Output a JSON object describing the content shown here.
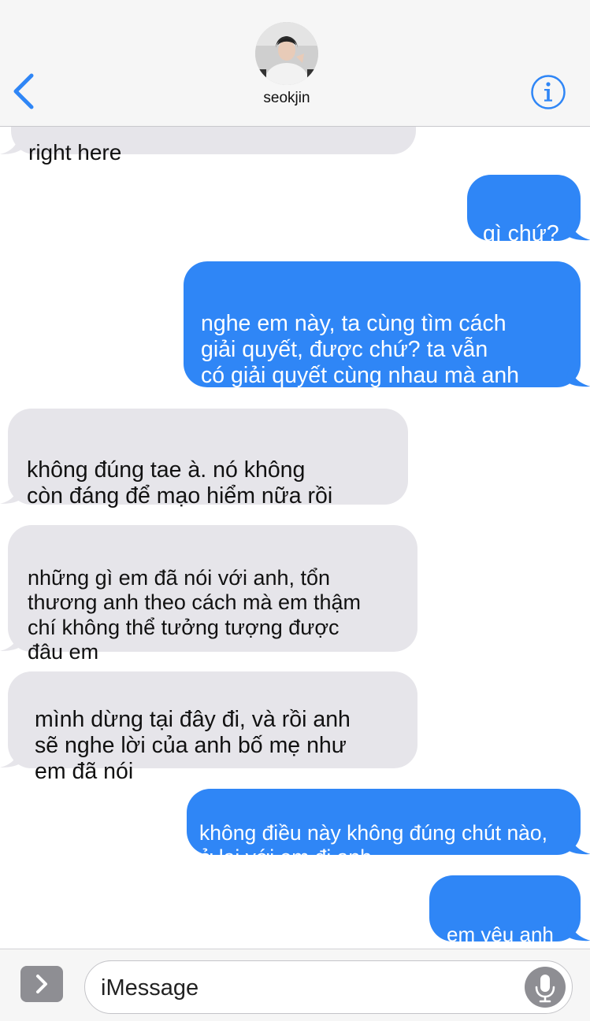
{
  "header": {
    "contact_name": "seokjin"
  },
  "messages": {
    "clipped_top": "right here",
    "m1": "gì chứ?",
    "m2": "nghe em này, ta cùng tìm cách\ngiải quyết, được chứ? ta vẫn\ncó giải quyết cùng nhau mà anh",
    "m3": "không đúng tae à. nó không\ncòn đáng để mạo hiểm nữa rồi",
    "m4": "những gì em đã nói với anh, tổn\nthương anh theo cách mà em thậm\nchí không thể tưởng tượng được\nđâu em",
    "m5": "mình dừng tại đây đi, và rồi anh\nsẽ nghe lời của anh bố mẹ như\nem đã nói",
    "m6": "không điều này không đúng chút nào,\nở lại với em đi anh",
    "m7": "em yêu anh"
  },
  "input": {
    "placeholder": "iMessage"
  },
  "colors": {
    "outgoing_bubble": "#2f86f6",
    "incoming_bubble": "#e6e5ea",
    "accent": "#2f86f6",
    "header_bg": "#f6f6f6"
  },
  "icons": {
    "back": "chevron-left-icon",
    "info": "info-icon",
    "expand": "chevron-right-icon",
    "mic": "microphone-icon"
  }
}
